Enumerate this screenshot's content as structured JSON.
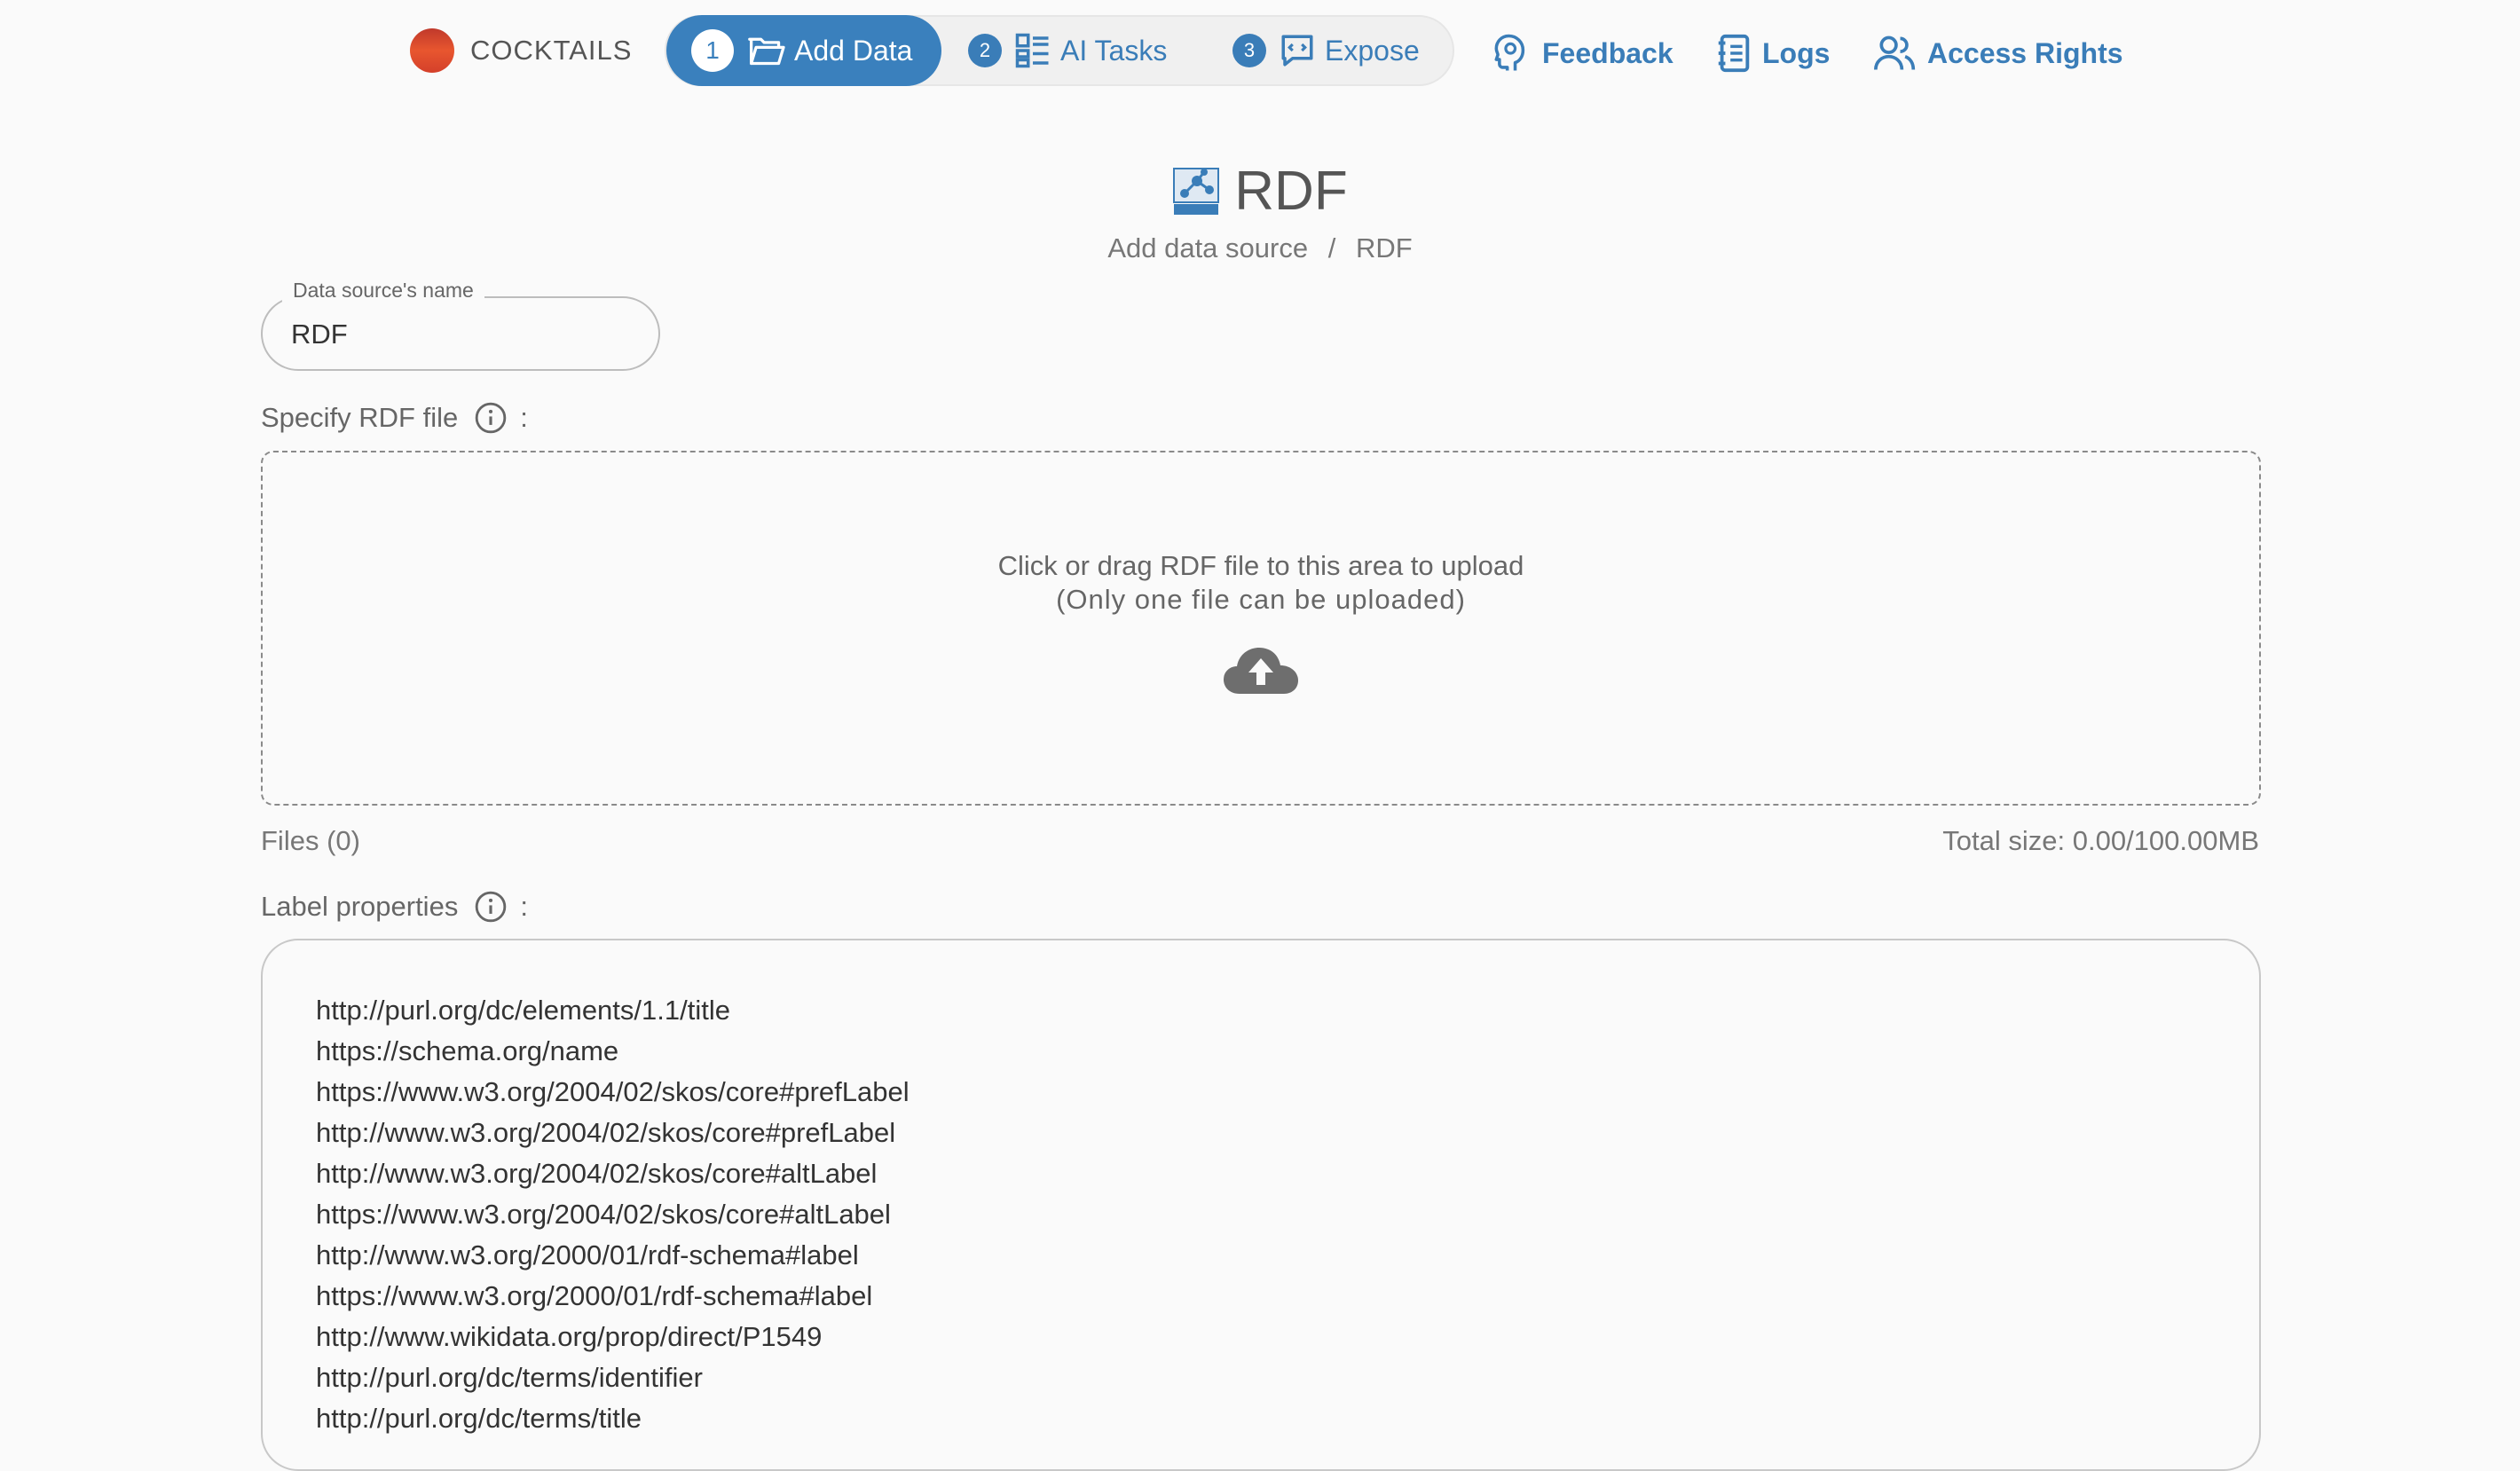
{
  "brand": {
    "name": "COCKTAILS"
  },
  "steps": [
    {
      "num": "1",
      "label": "Add Data"
    },
    {
      "num": "2",
      "label": "AI Tasks"
    },
    {
      "num": "3",
      "label": "Expose"
    }
  ],
  "nav": {
    "feedback": "Feedback",
    "logs": "Logs",
    "access_rights": "Access Rights"
  },
  "page": {
    "title": "RDF",
    "breadcrumb": [
      "Add data source",
      "RDF"
    ],
    "breadcrumb_sep": "/"
  },
  "name_field": {
    "label": "Data source's name",
    "value": "RDF"
  },
  "rdf_file": {
    "label": "Specify RDF file",
    "colon": ":",
    "drop_line1": "Click or drag RDF file to this area to upload",
    "drop_line2": "(Only one file can be uploaded)",
    "files": "Files (0)",
    "total_size": "Total size: 0.00/100.00MB"
  },
  "label_properties": {
    "label": "Label properties",
    "colon": ":",
    "items": [
      "http://purl.org/dc/elements/1.1/title",
      "https://schema.org/name",
      "https://www.w3.org/2004/02/skos/core#prefLabel",
      "http://www.w3.org/2004/02/skos/core#prefLabel",
      "http://www.w3.org/2004/02/skos/core#altLabel",
      "https://www.w3.org/2004/02/skos/core#altLabel",
      "http://www.w3.org/2000/01/rdf-schema#label",
      "https://www.w3.org/2000/01/rdf-schema#label",
      "http://www.wikidata.org/prop/direct/P1549",
      "http://purl.org/dc/terms/identifier",
      "http://purl.org/dc/terms/title"
    ]
  },
  "colors": {
    "accent": "#3a80bd",
    "brand_logo": "#d4402a"
  }
}
